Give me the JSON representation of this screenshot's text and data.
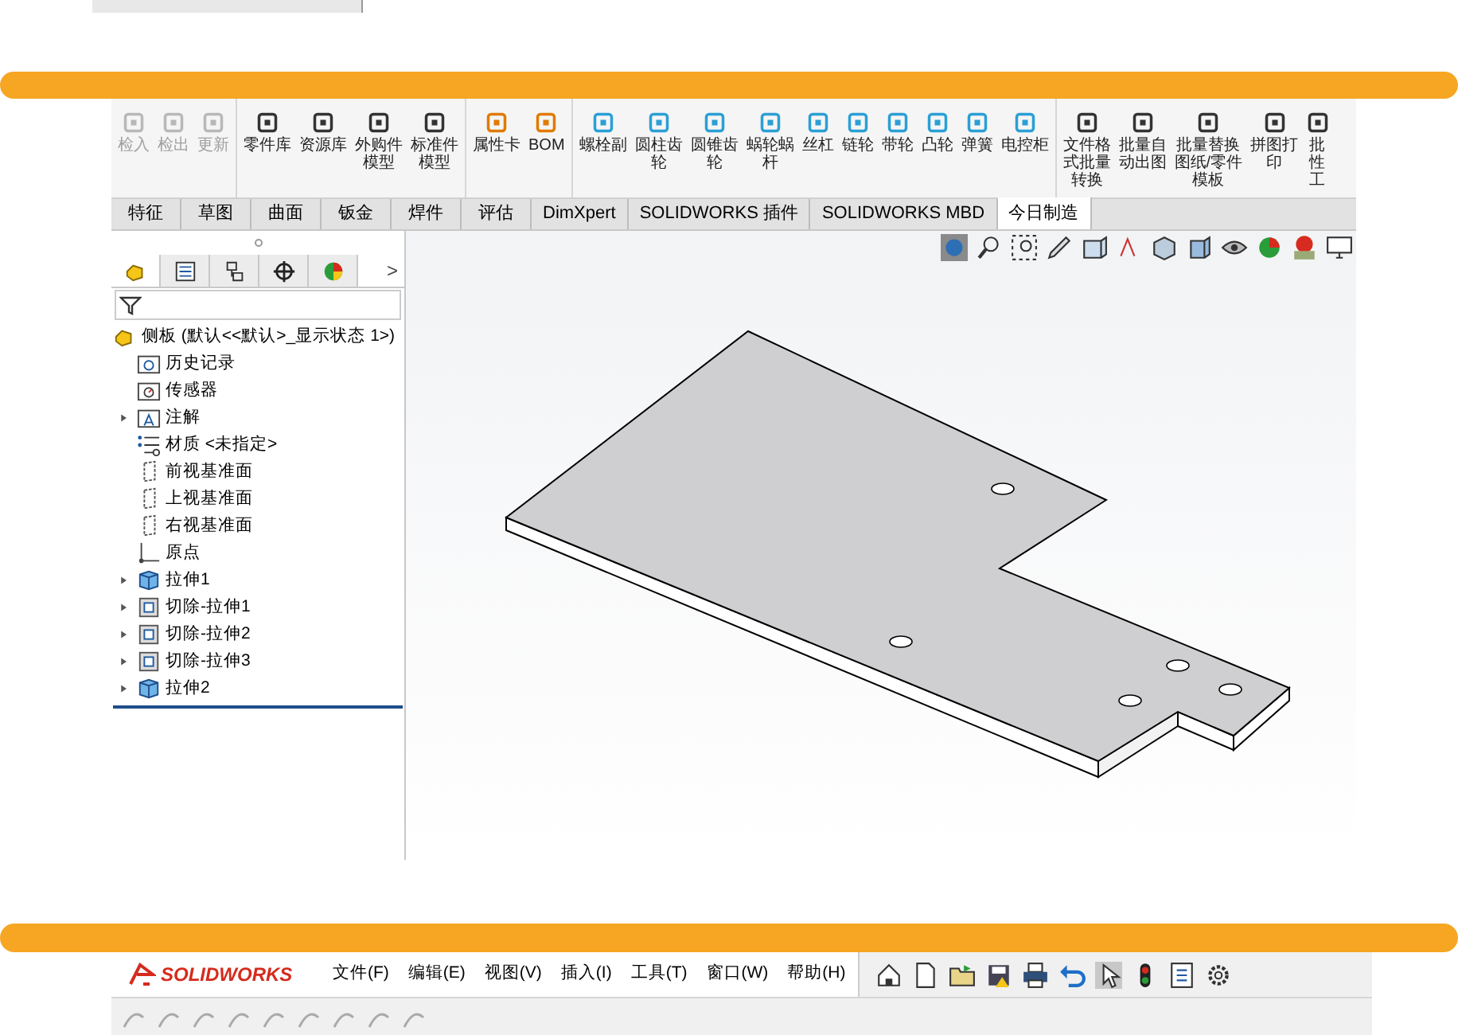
{
  "ribbon": {
    "groups": [
      {
        "buttons": [
          {
            "lines": [
              "检入"
            ],
            "disabled": true
          },
          {
            "lines": [
              "检出"
            ],
            "disabled": true
          },
          {
            "lines": [
              "更新"
            ],
            "disabled": true
          }
        ]
      },
      {
        "buttons": [
          {
            "lines": [
              "零件库"
            ],
            "disabled": false
          },
          {
            "lines": [
              "资源库"
            ],
            "disabled": false
          },
          {
            "lines": [
              "外购件",
              "模型"
            ],
            "disabled": false
          },
          {
            "lines": [
              "标准件",
              "模型"
            ],
            "disabled": false
          }
        ]
      },
      {
        "buttons": [
          {
            "lines": [
              "属性卡"
            ],
            "disabled": false
          },
          {
            "lines": [
              "BOM"
            ],
            "disabled": false
          }
        ]
      },
      {
        "buttons": [
          {
            "lines": [
              "螺栓副"
            ],
            "disabled": false
          },
          {
            "lines": [
              "圆柱齿",
              "轮"
            ],
            "disabled": false
          },
          {
            "lines": [
              "圆锥齿",
              "轮"
            ],
            "disabled": false
          },
          {
            "lines": [
              "蜗轮蜗",
              "杆"
            ],
            "disabled": false
          },
          {
            "lines": [
              "丝杠"
            ],
            "disabled": false
          },
          {
            "lines": [
              "链轮"
            ],
            "disabled": false
          },
          {
            "lines": [
              "带轮"
            ],
            "disabled": false
          },
          {
            "lines": [
              "凸轮"
            ],
            "disabled": false
          },
          {
            "lines": [
              "弹簧"
            ],
            "disabled": false
          },
          {
            "lines": [
              "电控柜"
            ],
            "disabled": false
          }
        ]
      },
      {
        "buttons": [
          {
            "lines": [
              "文件格",
              "式批量",
              "转换"
            ],
            "disabled": false
          },
          {
            "lines": [
              "批量自",
              "动出图"
            ],
            "disabled": false
          },
          {
            "lines": [
              "批量替换",
              "图纸/零件",
              "模板"
            ],
            "disabled": false
          },
          {
            "lines": [
              "拼图打",
              "印"
            ],
            "disabled": false
          },
          {
            "lines": [
              "批",
              "性",
              "工"
            ],
            "disabled": false
          }
        ]
      }
    ]
  },
  "command_tabs": [
    {
      "label": "特征",
      "selected": false
    },
    {
      "label": "草图",
      "selected": false
    },
    {
      "label": "曲面",
      "selected": false
    },
    {
      "label": "钣金",
      "selected": false
    },
    {
      "label": "焊件",
      "selected": false
    },
    {
      "label": "评估",
      "selected": false
    },
    {
      "label": "DimXpert",
      "selected": false
    },
    {
      "label": "SOLIDWORKS 插件",
      "selected": false
    },
    {
      "label": "SOLIDWORKS MBD",
      "selected": false
    },
    {
      "label": "今日制造",
      "selected": true
    }
  ],
  "feature_manager": {
    "tabs": [
      {
        "kind": "part",
        "selected": true
      },
      {
        "kind": "property",
        "selected": false
      },
      {
        "kind": "config",
        "selected": false
      },
      {
        "kind": "crosshair",
        "selected": false
      },
      {
        "kind": "appearance",
        "selected": false
      }
    ],
    "more": ">",
    "tree": {
      "label": "侧板 (默认<<默认>_显示状态 1>)",
      "children": [
        {
          "label": "历史记录",
          "kind": "history",
          "expandable": false
        },
        {
          "label": "传感器",
          "kind": "sensor",
          "expandable": false
        },
        {
          "label": "注解",
          "kind": "annotation",
          "expandable": true
        },
        {
          "label": "材质 <未指定>",
          "kind": "material",
          "expandable": false
        },
        {
          "label": "前视基准面",
          "kind": "plane",
          "expandable": false
        },
        {
          "label": "上视基准面",
          "kind": "plane",
          "expandable": false
        },
        {
          "label": "右视基准面",
          "kind": "plane",
          "expandable": false
        },
        {
          "label": "原点",
          "kind": "origin",
          "expandable": false
        },
        {
          "label": "拉伸1",
          "kind": "extrude",
          "expandable": true
        },
        {
          "label": "切除-拉伸1",
          "kind": "cut",
          "expandable": true
        },
        {
          "label": "切除-拉伸2",
          "kind": "cut",
          "expandable": true
        },
        {
          "label": "切除-拉伸3",
          "kind": "cut",
          "expandable": true
        },
        {
          "label": "拉伸2",
          "kind": "extrude",
          "expandable": true
        }
      ]
    }
  },
  "bottom_bar": {
    "logo": "SOLIDWORKS",
    "menu": [
      "文件(F)",
      "编辑(E)",
      "视图(V)",
      "插入(I)",
      "工具(T)",
      "窗口(W)",
      "帮助(H)"
    ]
  }
}
